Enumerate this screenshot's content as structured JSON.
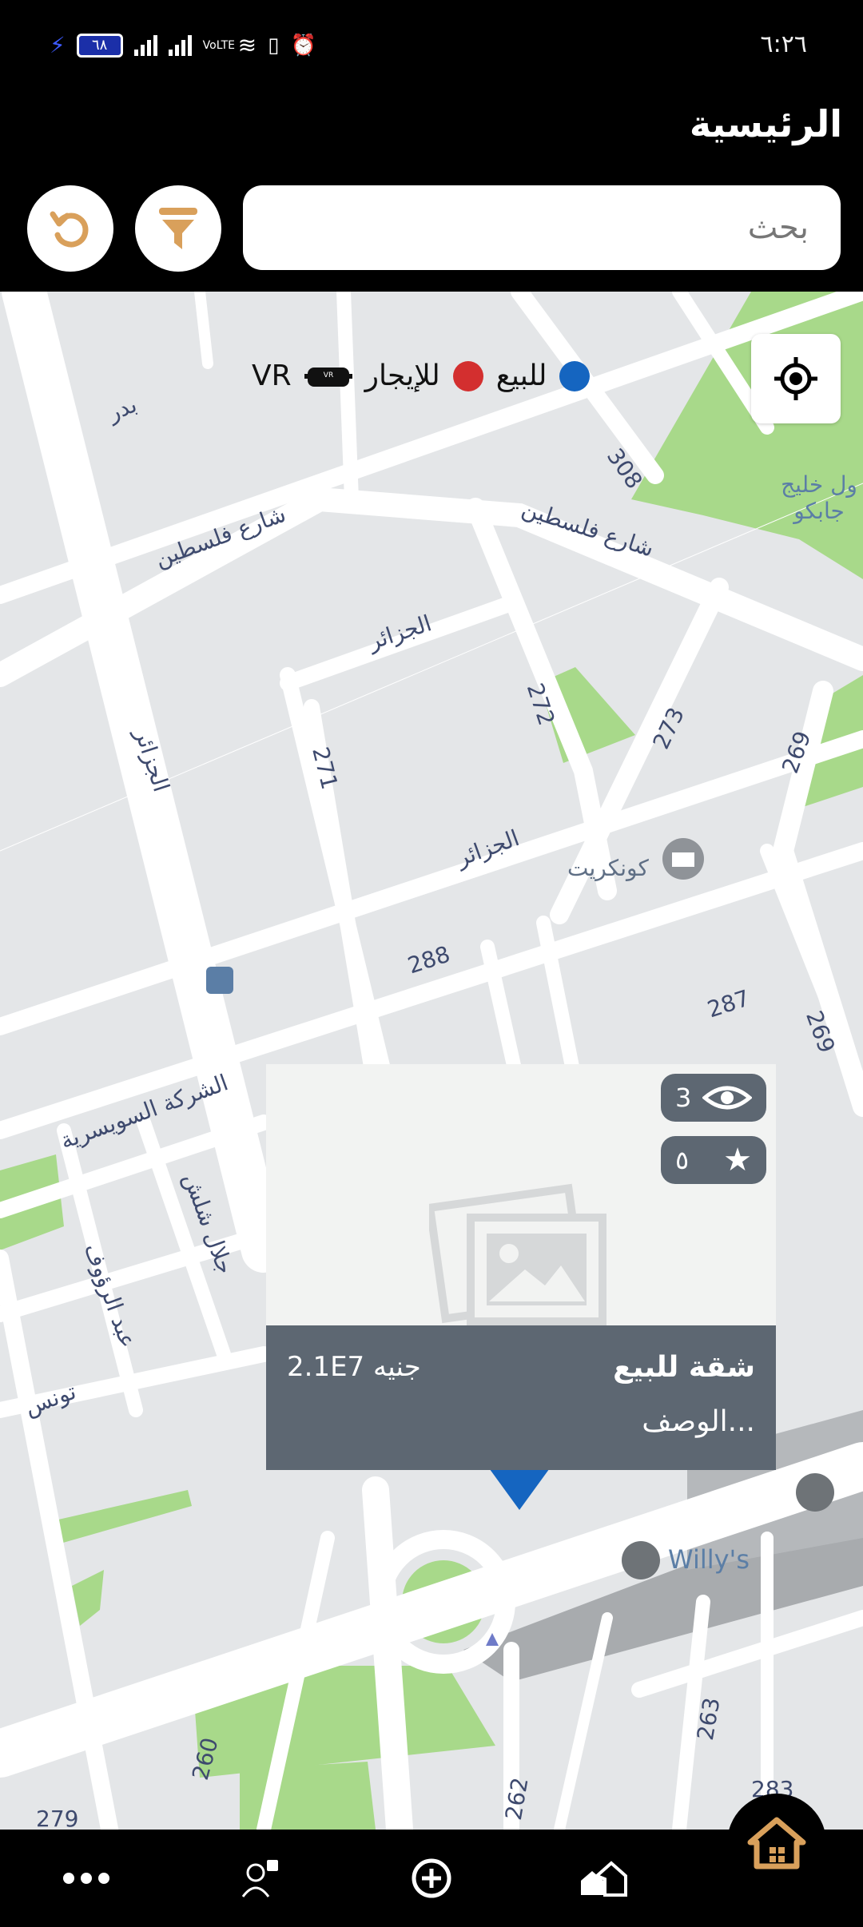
{
  "status_bar": {
    "time": "٦:٢٦",
    "battery": "٦٨",
    "network_label": "VoLTE"
  },
  "header": {
    "title": "الرئيسية"
  },
  "search": {
    "placeholder": "بحث"
  },
  "legend": {
    "for_sale": "للبيع",
    "for_rent": "للإيجار",
    "vr": "VR",
    "sale_color": "#1565c0",
    "rent_color": "#d32f2f"
  },
  "map": {
    "labels": [
      "شارع فلسطين",
      "شارع فلسطين",
      "الجزائر",
      "الجزائر",
      "الجزائر",
      "بدر",
      "271",
      "272",
      "273",
      "269",
      "269",
      "288",
      "287",
      "308",
      "كونكريت",
      "الشركة السويسرية",
      "جلال شلش",
      "عبد الرؤوف",
      "تونس",
      "Willy's",
      "260",
      "262",
      "263",
      "283",
      "279",
      "ول خليج جابكو"
    ]
  },
  "listing_card": {
    "views": "3",
    "rating": "٥",
    "title": "شقة للبيع",
    "price": "2.1E7 جنيه",
    "description": "الوصف..."
  },
  "bottom_nav": {
    "items": [
      "more-icon",
      "agent-icon",
      "add-icon",
      "properties-icon",
      "home-icon"
    ],
    "accent": "#d9a05b"
  }
}
